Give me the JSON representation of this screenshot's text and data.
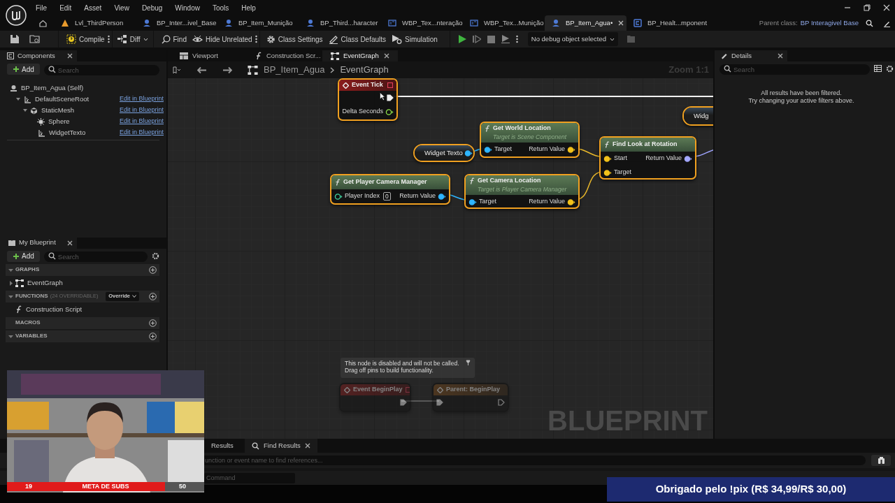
{
  "menu": [
    "File",
    "Edit",
    "Asset",
    "View",
    "Debug",
    "Window",
    "Tools",
    "Help"
  ],
  "doc_tabs": [
    {
      "label": "Lvl_ThirdPerson",
      "kind": "level",
      "selected": false
    },
    {
      "label": "BP_Inter...ivel_Base",
      "kind": "blueprint",
      "selected": false
    },
    {
      "label": "BP_Item_Munição",
      "kind": "blueprint",
      "selected": false
    },
    {
      "label": "BP_Third...haracter",
      "kind": "blueprint",
      "selected": false
    },
    {
      "label": "WBP_Tex...nteração",
      "kind": "widget",
      "selected": false
    },
    {
      "label": "WBP_Tex...Munição",
      "kind": "widget",
      "selected": false
    },
    {
      "label": "BP_Item_Agua•",
      "kind": "blueprint",
      "selected": true
    },
    {
      "label": "BP_Healt...mponent",
      "kind": "component",
      "selected": false
    }
  ],
  "parent_class": {
    "label": "Parent class:",
    "value": "BP Interagivel Base"
  },
  "toolbar": [
    {
      "label": "Compile",
      "kind": "compile"
    },
    {
      "label": "Diff",
      "kind": "diff"
    },
    {
      "label": "Find",
      "kind": "find"
    },
    {
      "label": "Hide Unrelated",
      "kind": "hide"
    },
    {
      "label": "Class Settings",
      "kind": "settings"
    },
    {
      "label": "Class Defaults",
      "kind": "defaults"
    },
    {
      "label": "Simulation",
      "kind": "simulation"
    }
  ],
  "debug_selector": "No debug object selected",
  "components": {
    "title": "Components",
    "add": "Add",
    "search_placeholder": "Search",
    "root": "BP_Item_Agua (Self)",
    "tree": [
      {
        "name": "DefaultSceneRoot",
        "kind": "scene",
        "action": "Edit in Blueprint",
        "expanded": true,
        "children": [
          {
            "name": "StaticMesh",
            "kind": "mesh",
            "action": "Edit in Blueprint",
            "expanded": true,
            "children": [
              {
                "name": "Sphere",
                "kind": "collision",
                "action": "Edit in Blueprint"
              },
              {
                "name": "WidgetTexto",
                "kind": "scene",
                "action": "Edit in Blueprint"
              }
            ]
          }
        ]
      }
    ]
  },
  "my_blueprint": {
    "title": "My Blueprint",
    "add": "Add",
    "search_placeholder": "Search",
    "sections": [
      {
        "title": "GRAPHS",
        "expanded": true,
        "items": [
          {
            "label": "EventGraph",
            "kind": "graph",
            "expanded": false
          }
        ]
      },
      {
        "title": "FUNCTIONS",
        "note": "(24 OVERRIDABLE)",
        "override": "Override",
        "expanded": true,
        "items": [
          {
            "label": "Construction Script",
            "kind": "function"
          }
        ]
      },
      {
        "title": "MACROS"
      },
      {
        "title": "VARIABLES",
        "expanded": true
      }
    ]
  },
  "graph_tabs": [
    {
      "label": "Viewport",
      "kind": "viewport",
      "selected": false
    },
    {
      "label": "Construction Scr...",
      "kind": "function",
      "selected": false
    },
    {
      "label": "EventGraph",
      "kind": "graph",
      "selected": true
    }
  ],
  "breadcrumb": [
    "BP_Item_Agua",
    "EventGraph"
  ],
  "zoom": "Zoom 1:1",
  "graph": {
    "nodes": [
      {
        "kind": "event",
        "title": "Event Tick",
        "selected": true,
        "disabled": false,
        "outputs": [
          {
            "kind": "exec",
            "connected": true
          },
          {
            "kind": "float",
            "label": "Delta Seconds",
            "connected": false
          }
        ]
      },
      {
        "kind": "function",
        "title": "Get World Location",
        "subtitle": "Target is Scene Component",
        "selected": true,
        "disabled": false,
        "inputs": [
          {
            "kind": "object",
            "label": "Target",
            "connected": true
          }
        ],
        "outputs": [
          {
            "kind": "vector",
            "label": "Return Value",
            "connected": true
          }
        ]
      },
      {
        "kind": "variable",
        "title": "Widget Texto",
        "selected": true,
        "disabled": false,
        "outputs": [
          {
            "kind": "object",
            "connected": true
          }
        ]
      },
      {
        "kind": "function",
        "title": "Find Look at Rotation",
        "selected": true,
        "disabled": false,
        "inputs": [
          {
            "kind": "vector",
            "label": "Start",
            "connected": true
          },
          {
            "kind": "vector",
            "label": "Target",
            "connected": true
          }
        ],
        "outputs": [
          {
            "kind": "rotator",
            "label": "Return Value",
            "connected": true
          }
        ]
      },
      {
        "kind": "function",
        "title": "Get Player Camera Manager",
        "selected": true,
        "disabled": false,
        "inputs": [
          {
            "kind": "int",
            "label": "Player Index",
            "default": "0",
            "connected": false
          }
        ],
        "outputs": [
          {
            "kind": "object",
            "label": "Return Value",
            "connected": true
          }
        ]
      },
      {
        "kind": "function",
        "title": "Get Camera Location",
        "subtitle": "Target is Player Camera Manager",
        "selected": true,
        "disabled": false,
        "inputs": [
          {
            "kind": "object",
            "label": "Target",
            "connected": true
          }
        ],
        "outputs": [
          {
            "kind": "vector",
            "label": "Return Value",
            "connected": true
          }
        ]
      },
      {
        "kind": "variable",
        "title": "Widg",
        "selected": true,
        "disabled": false
      },
      {
        "kind": "event",
        "title": "Event BeginPlay",
        "selected": false,
        "disabled": true,
        "outputs": [
          {
            "kind": "exec",
            "connected": true
          }
        ]
      },
      {
        "kind": "parent",
        "title": "Parent: BeginPlay",
        "selected": false,
        "disabled": true,
        "inputs": [
          {
            "kind": "exec",
            "connected": true
          }
        ],
        "outputs": [
          {
            "kind": "exec",
            "connected": false
          }
        ]
      }
    ],
    "comment": "This node is disabled and will not be called.\nDrag off pins to build functionality.",
    "watermark": "BLUEPRINT"
  },
  "details": {
    "title": "Details",
    "search_placeholder": "Search",
    "message": "All results have been filtered.\nTry changing your active filters above."
  },
  "bottom_tabs": [
    {
      "label": "Results",
      "selected": false
    },
    {
      "label": "Find Results",
      "selected": true
    }
  ],
  "find_placeholder": "unction or event name to find references...",
  "command_placeholder": "Command",
  "stream_overlay": {
    "goal_current": "19",
    "goal_label": "META DE SUBS",
    "goal_target": "50",
    "level": 0.8,
    "banner": "Obrigado pelo !pix (R$ 34,99/R$ 30,00)"
  }
}
